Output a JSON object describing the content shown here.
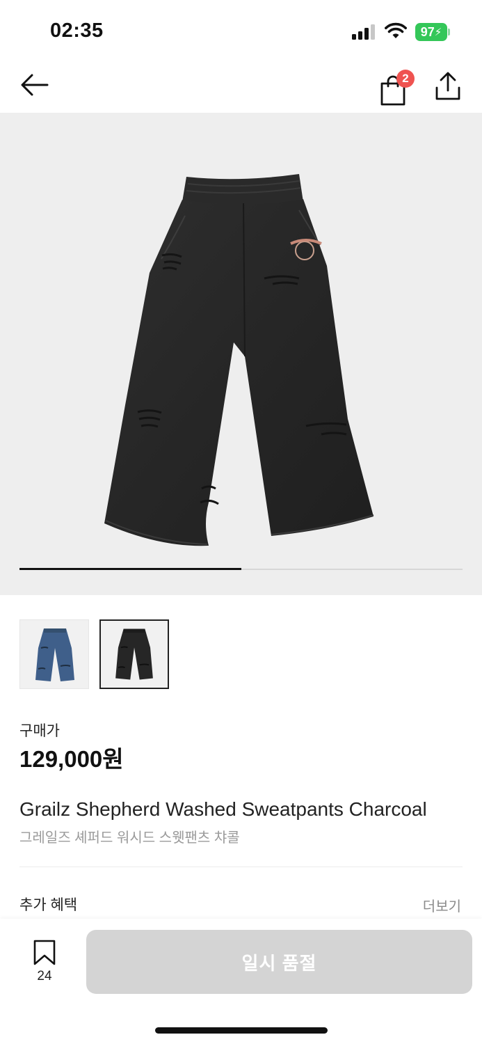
{
  "status_bar": {
    "time": "02:35",
    "battery": "97"
  },
  "nav": {
    "back_icon": "arrow-left-icon",
    "cart_icon": "shopping-bag-icon",
    "cart_count": "2",
    "share_icon": "share-icon"
  },
  "gallery": {
    "progress_fraction": 0.5,
    "thumbnails": [
      {
        "color": "blue",
        "selected": false
      },
      {
        "color": "charcoal",
        "selected": true
      }
    ]
  },
  "price": {
    "label": "구매가",
    "value": "129,000원"
  },
  "product": {
    "name_en": "Grailz Shepherd Washed Sweatpants Charcoal",
    "name_ko": "그레일즈 셰퍼드 워시드 스웻팬츠 챠콜"
  },
  "benefits": {
    "label": "추가 혜택",
    "more": "더보기"
  },
  "bottom_bar": {
    "bookmark_icon": "bookmark-icon",
    "bookmark_count": "24",
    "action_label": "일시 품절"
  },
  "colors": {
    "badge": "#ef5350",
    "battery": "#34c759",
    "disabled_button": "#d4d4d4"
  }
}
